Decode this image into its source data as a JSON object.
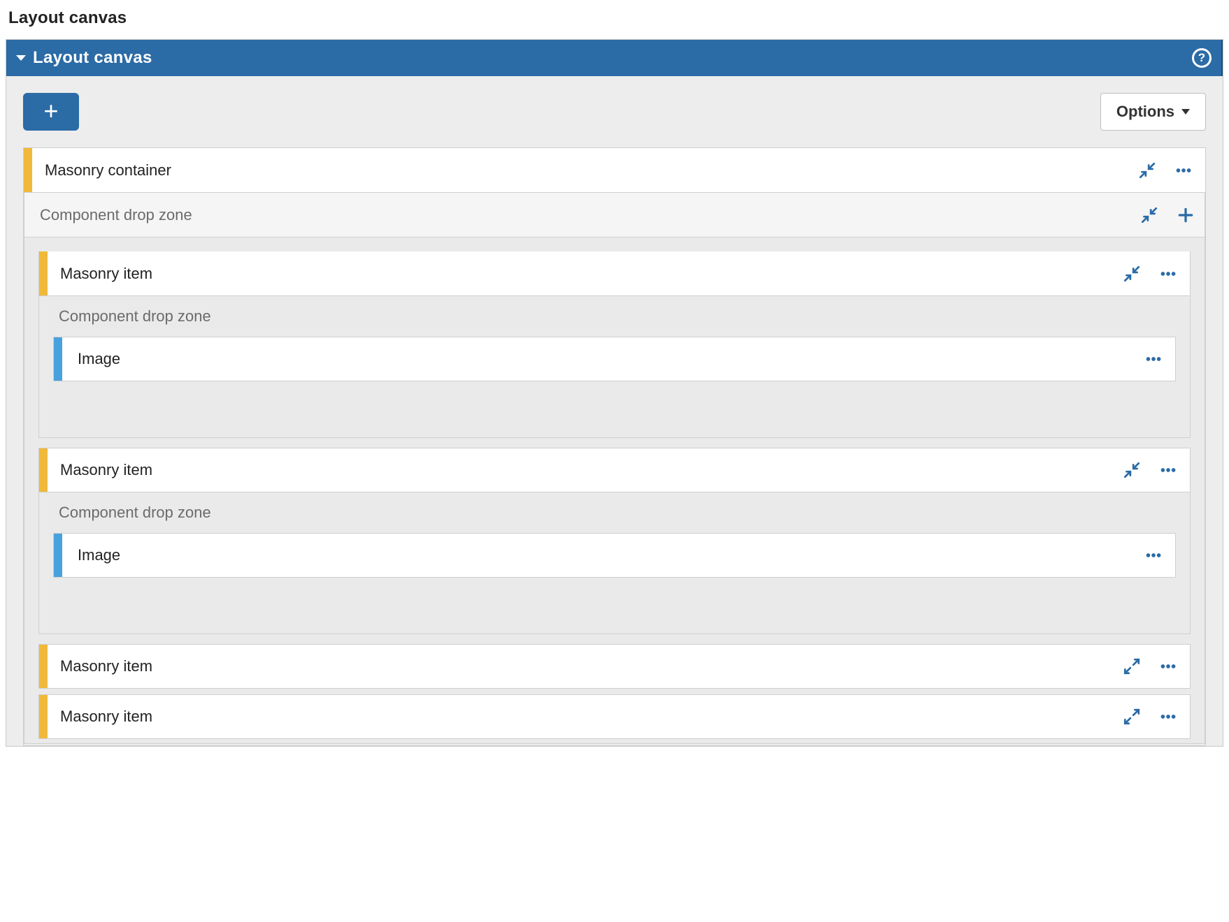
{
  "colors": {
    "accent": "#2b6ba6",
    "component_bar": "#f0b93a",
    "element_bar": "#47a1dd",
    "muted_text": "#6b6b6b"
  },
  "page": {
    "title": "Layout canvas"
  },
  "panel": {
    "title": "Layout canvas",
    "help_char": "?",
    "options_label": "Options"
  },
  "tree": {
    "masonry_container": "Masonry container",
    "component_drop_zone": "Component drop zone",
    "masonry_item": "Masonry item",
    "image": "Image"
  },
  "items": {
    "container": {
      "label_key": "masonry_container",
      "has_collapse": true,
      "has_more": true
    },
    "outer_dropzone": {
      "label_key": "component_drop_zone",
      "has_collapse": true,
      "has_add": true
    },
    "children": [
      {
        "label_key": "masonry_item",
        "expanded": true,
        "inner_dropzone_label_key": "component_drop_zone",
        "leaves": [
          {
            "label_key": "image"
          }
        ]
      },
      {
        "label_key": "masonry_item",
        "expanded": true,
        "inner_dropzone_label_key": "component_drop_zone",
        "leaves": [
          {
            "label_key": "image"
          }
        ]
      },
      {
        "label_key": "masonry_item",
        "expanded": false
      },
      {
        "label_key": "masonry_item",
        "expanded": false
      }
    ]
  }
}
